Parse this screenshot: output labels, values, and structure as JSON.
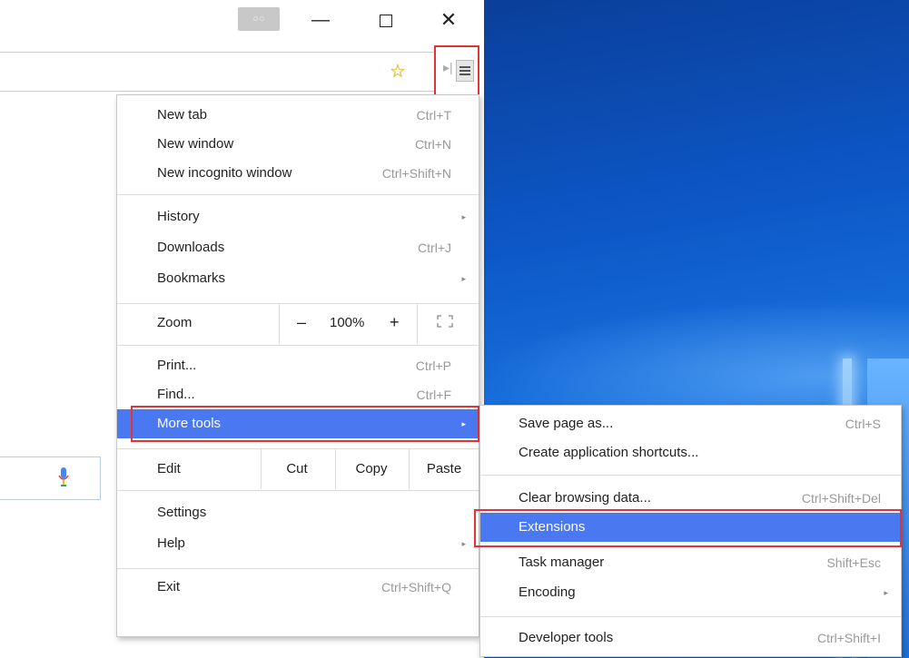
{
  "window": {
    "avatar_label": "○○",
    "minimize_glyph": "—",
    "close_glyph": "✕"
  },
  "toolbar": {
    "star_icon": "☆",
    "separator_glyph": "▸|"
  },
  "menu": {
    "items": [
      {
        "label": "New tab",
        "shortcut": "Ctrl+T"
      },
      {
        "label": "New window",
        "shortcut": "Ctrl+N"
      },
      {
        "label": "New incognito window",
        "shortcut": "Ctrl+Shift+N"
      },
      {
        "label": "History",
        "shortcut": ""
      },
      {
        "label": "Downloads",
        "shortcut": "Ctrl+J"
      },
      {
        "label": "Bookmarks",
        "shortcut": ""
      },
      {
        "label": "Print...",
        "shortcut": "Ctrl+P"
      },
      {
        "label": "Find...",
        "shortcut": "Ctrl+F"
      },
      {
        "label": "More tools",
        "shortcut": ""
      },
      {
        "label": "Settings",
        "shortcut": ""
      },
      {
        "label": "Help",
        "shortcut": ""
      },
      {
        "label": "Exit",
        "shortcut": "Ctrl+Shift+Q"
      }
    ],
    "zoom": {
      "label": "Zoom",
      "minus": "–",
      "level": "100%",
      "plus": "+"
    },
    "edit": {
      "label": "Edit",
      "cut": "Cut",
      "copy": "Copy",
      "paste": "Paste"
    },
    "arrow_glyph": "▸"
  },
  "submenu": {
    "items": [
      {
        "label": "Save page as...",
        "shortcut": "Ctrl+S"
      },
      {
        "label": "Create application shortcuts...",
        "shortcut": ""
      },
      {
        "label": "Clear browsing data...",
        "shortcut": "Ctrl+Shift+Del"
      },
      {
        "label": "Extensions",
        "shortcut": ""
      },
      {
        "label": "Task manager",
        "shortcut": "Shift+Esc"
      },
      {
        "label": "Encoding",
        "shortcut": ""
      },
      {
        "label": "Developer tools",
        "shortcut": "Ctrl+Shift+I"
      }
    ]
  },
  "colors": {
    "highlight": "#4a78f0",
    "annotation_red": "#e0343b",
    "desktop_blue": "#0d58c8"
  }
}
